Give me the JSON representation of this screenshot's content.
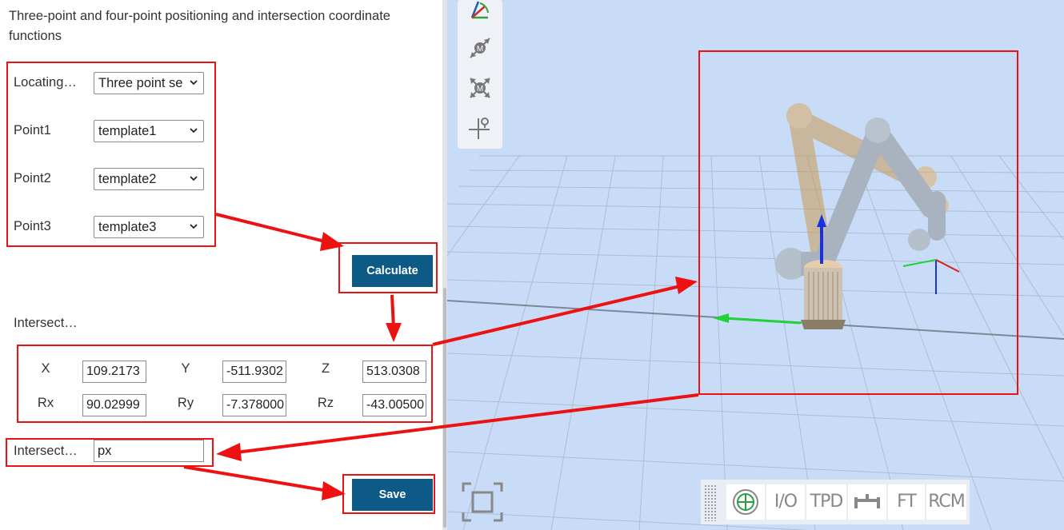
{
  "left_panel": {
    "title": "Three-point and four-point positioning and intersection coordinate functions",
    "locating_label": "Locating…",
    "locating_value": "Three point se",
    "point1_label": "Point1",
    "point1_value": "template1",
    "point2_label": "Point2",
    "point2_value": "template2",
    "point3_label": "Point3",
    "point3_value": "template3",
    "calculate_label": "Calculate",
    "result_label": "Intersect…",
    "coords": {
      "x_label": "X",
      "x_value": "109.2173",
      "y_label": "Y",
      "y_value": "-511.9302",
      "z_label": "Z",
      "z_value": "513.0308",
      "rx_label": "Rx",
      "rx_value": "90.02999",
      "ry_label": "Ry",
      "ry_value": "-7.378000",
      "rz_label": "Rz",
      "rz_value": "-43.00500"
    },
    "name_label": "Intersect…",
    "name_value": "px",
    "save_label": "Save"
  },
  "viewport": {
    "toolbar_icons": [
      "coordinate-frame-icon",
      "move-m-icon",
      "scale-m-icon",
      "pin-axes-icon"
    ],
    "bottom_bar": [
      "grip-icon",
      "target-icon",
      "I/O",
      "TPD",
      "tool-icon",
      "FT",
      "RCM"
    ],
    "bottom_io": "I/O",
    "bottom_tpd": "TPD",
    "bottom_ft": "FT",
    "bottom_rcm": "RCM",
    "fit_icon": "fit-screen-icon"
  },
  "colors": {
    "button": "#0e5a86",
    "highlight": "#ee1111",
    "viewport_bg": "#c9dcf7"
  }
}
